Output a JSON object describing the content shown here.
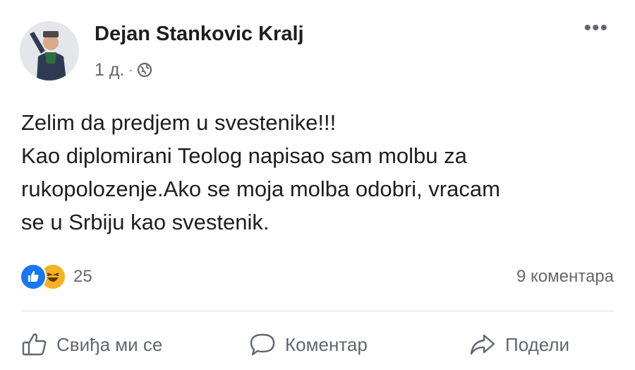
{
  "post": {
    "author": "Dejan Stankovic Kralj",
    "timestamp": "1 д.",
    "separator": "·",
    "audience_icon": "globe-icon",
    "more_label": "•••",
    "text_lines": [
      "Zelim da predjem u svestenike!!!",
      "Kao diplomirani Teolog napisao sam molbu za",
      "rukopolozenje.Ako se moja molba odobri, vracam",
      "se u Srbiju kao svestenik."
    ]
  },
  "reactions": {
    "types": [
      "like-icon",
      "haha-icon"
    ],
    "count": "25",
    "comments": "9 коментара"
  },
  "actions": {
    "like": "Свиђа ми се",
    "comment": "Коментар",
    "share": "Подели"
  },
  "colors": {
    "like_blue": "#1877f2",
    "haha_yellow": "#f7b125",
    "secondary_text": "#65676b",
    "primary_text": "#1c1e21"
  }
}
